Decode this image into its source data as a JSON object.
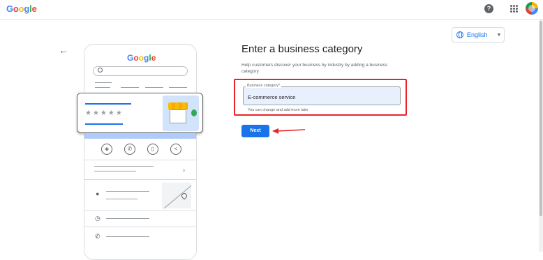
{
  "header": {
    "logo_text": "Google",
    "help_icon": "question-circle-icon",
    "apps_icon": "apps-grid-icon",
    "avatar_icon": "account-avatar"
  },
  "language": {
    "selected": "English"
  },
  "illustration": {
    "logo_text": "Google",
    "stars": "★★★★★"
  },
  "form": {
    "title": "Enter a business category",
    "help_text": "Help customers discover your business by industry by adding a business category",
    "field_label": "Business category*",
    "field_value": "E-commerce service",
    "hint": "You can change and add more later",
    "next_label": "Next"
  },
  "colors": {
    "accent": "#1a73e8",
    "highlight_red": "#e8232a"
  }
}
